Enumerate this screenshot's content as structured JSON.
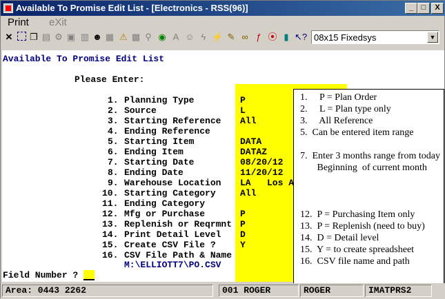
{
  "window": {
    "title": "Available To Promise Edit List - [Electronics - RSS(96)]"
  },
  "title_buttons": {
    "minimize": "_",
    "maximize": "□",
    "close": "X"
  },
  "menu": {
    "print": "Print",
    "exit": "eXit"
  },
  "toolbar": {
    "font_value": "08x15 Fixedsys"
  },
  "screen": {
    "heading": "Available To Promise Edit List",
    "prompt": "Please Enter:",
    "fields": [
      {
        "num": "1.",
        "label": "Planning Type",
        "value": "P"
      },
      {
        "num": "2.",
        "label": "Source",
        "value": "L"
      },
      {
        "num": "3.",
        "label": "Starting Reference",
        "value": "All"
      },
      {
        "num": "4.",
        "label": "Ending Reference",
        "value": ""
      },
      {
        "num": "5.",
        "label": "Starting Item",
        "value": "DATA"
      },
      {
        "num": "6.",
        "label": "Ending Item",
        "value": "DATAZ"
      },
      {
        "num": "7.",
        "label": "Starting Date",
        "value": "08/20/12"
      },
      {
        "num": "8.",
        "label": "Ending Date",
        "value": "11/20/12"
      },
      {
        "num": "9.",
        "label": "Warehouse Location",
        "value": "LA   Los A"
      },
      {
        "num": "10.",
        "label": "Starting Category",
        "value": "All"
      },
      {
        "num": "11.",
        "label": "Ending Category",
        "value": ""
      },
      {
        "num": "12.",
        "label": "Mfg or Purchase",
        "value": "P"
      },
      {
        "num": "13.",
        "label": "Replenish or Reqrmnt",
        "value": "P"
      },
      {
        "num": "14.",
        "label": "Print Detail Level",
        "value": "D"
      },
      {
        "num": "15.",
        "label": "Create CSV File ?",
        "value": "Y"
      },
      {
        "num": "16.",
        "label": "CSV File Path & Name",
        "value": ""
      }
    ],
    "csv_path": "M:\\ELLIOTT7\\PO.CSV",
    "field_number_label": "Field Number ?"
  },
  "notes": [
    "1.     P = Plan Order",
    "2.     L = Plan type only",
    "3.     All Reference",
    "5.  Can be entered item range",
    "7.  Enter 3 months range from today",
    "       Beginning  of current month",
    "12.  P = Purchasing Item only",
    "13.  P = Replenish (need to buy)",
    "14.  D = Detail level",
    "15.  Y = to create spreadsheet",
    "16.  CSV file name and path"
  ],
  "status_bar": {
    "area": "Area: 0443 2262",
    "user": "001 ROGER",
    "user2": "ROGER",
    "program": "IMATPRS2"
  }
}
